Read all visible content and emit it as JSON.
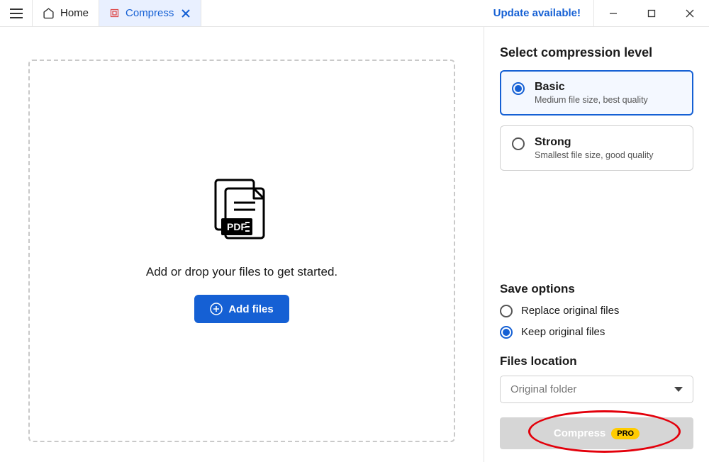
{
  "titlebar": {
    "home_label": "Home",
    "compress_label": "Compress",
    "update_label": "Update available!"
  },
  "dropzone": {
    "message": "Add or drop your files to get started.",
    "add_button": "Add files"
  },
  "sidebar": {
    "compression_title": "Select compression level",
    "options": [
      {
        "title": "Basic",
        "sub": "Medium file size, best quality",
        "selected": true
      },
      {
        "title": "Strong",
        "sub": "Smallest file size, good quality",
        "selected": false
      }
    ],
    "save_title": "Save options",
    "save_options": [
      {
        "label": "Replace original files",
        "selected": false
      },
      {
        "label": "Keep original files",
        "selected": true
      }
    ],
    "location_title": "Files location",
    "location_value": "Original folder",
    "compress_button": "Compress",
    "pro_badge": "PRO"
  }
}
